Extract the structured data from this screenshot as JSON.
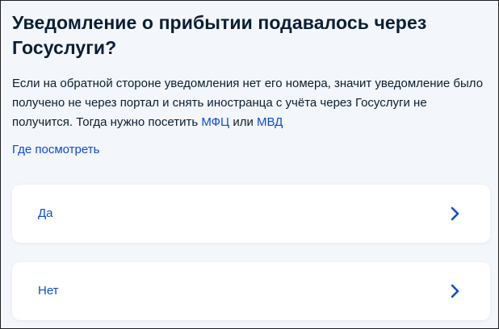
{
  "question": {
    "title": "Уведомление о прибытии подавалось через Госуслуги?",
    "description_text": "Если на обратной стороне уведомления нет его номера, значит уведомление было получено не через портал и снять иностранца с учёта через Госуслуги не получится. Тогда нужно посетить ",
    "link_mfc": "МФЦ",
    "connector": " или ",
    "link_mvd": "МВД",
    "where_to_look": "Где посмотреть"
  },
  "options": [
    {
      "label": "Да",
      "icon": "chevron-right-icon"
    },
    {
      "label": "Нет",
      "icon": "chevron-right-icon"
    }
  ],
  "colors": {
    "background": "#f3f6fb",
    "card": "#ffffff",
    "text": "#0b1f33",
    "link": "#0d4cd3"
  }
}
